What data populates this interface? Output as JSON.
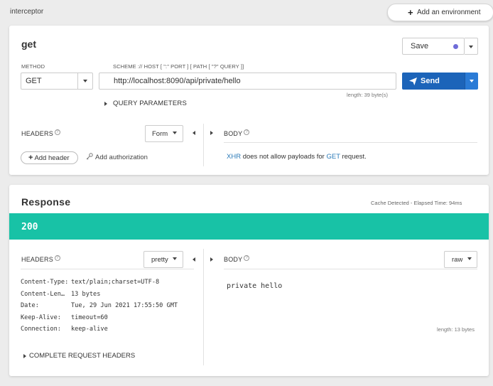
{
  "topbar": {
    "title": "interceptor",
    "env_button": "Add an environment"
  },
  "request": {
    "name": "get",
    "save_label": "Save",
    "method_label": "METHOD",
    "method_value": "GET",
    "url_label": "SCHEME :// HOST [ \":\" PORT ] [ PATH [ \"?\" QUERY ]]",
    "url_value": "http://localhost:8090/api/private/hello",
    "url_length": "length: 39 byte(s)",
    "send_label": "Send",
    "query_params": "QUERY PARAMETERS",
    "headers_label": "HEADERS",
    "form_label": "Form",
    "body_label": "BODY",
    "add_header": "Add header",
    "add_authorization": "Add authorization",
    "xhr_note": {
      "xhr": "XHR",
      "mid": " does not allow payloads for ",
      "get": "GET",
      "end": " request."
    }
  },
  "response": {
    "title": "Response",
    "cache_info": "Cache Detected - Elapsed Time: 94ms",
    "status_code": "200",
    "headers_label": "HEADERS",
    "pretty_label": "pretty",
    "body_label": "BODY",
    "raw_label": "raw",
    "headers": [
      {
        "key": "Content-Type:",
        "value": "text/plain;charset=UTF-8"
      },
      {
        "key": "Content-Len…",
        "value": "13 bytes"
      },
      {
        "key": "Date:",
        "value": "Tue, 29 Jun 2021 17:55:50 GMT"
      },
      {
        "key": "Keep-Alive:",
        "value": "timeout=60"
      },
      {
        "key": "Connection:",
        "value": "keep-alive"
      }
    ],
    "body": "private hello",
    "body_length": "length: 13 bytes",
    "complete_request_headers": "COMPLETE REQUEST HEADERS"
  },
  "colors": {
    "status_bar": "#18c2a6",
    "send_button": "#1c64b9",
    "save_dot": "#6f6cd8",
    "link": "#2a7ab8"
  },
  "icons": [
    "plus-icon",
    "paper-plane-icon",
    "help-icon",
    "key-icon",
    "triangle-right-icon",
    "triangle-left-icon",
    "caret-down-icon"
  ]
}
